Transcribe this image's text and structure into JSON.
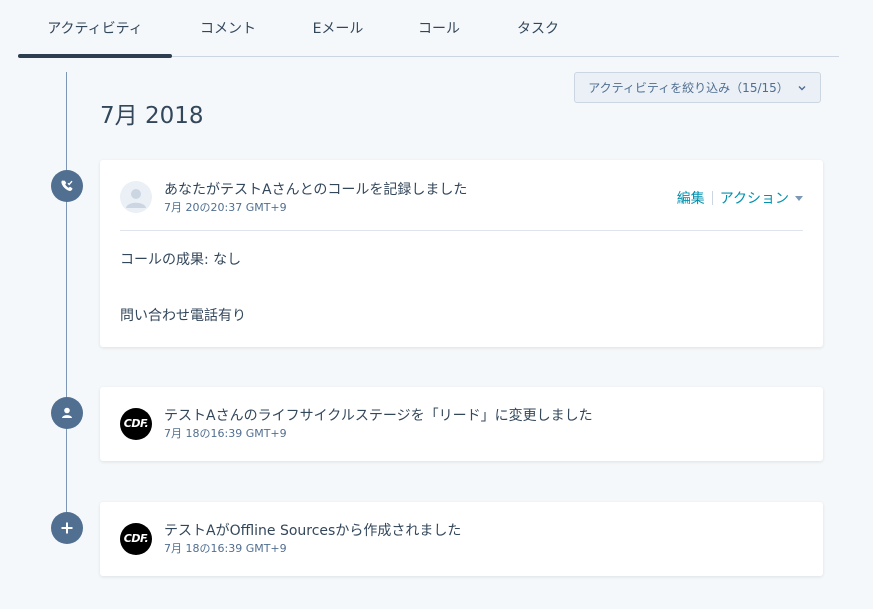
{
  "tabs": [
    {
      "label": "アクティビティ",
      "active": true
    },
    {
      "label": "コメント",
      "active": false
    },
    {
      "label": "Eメール",
      "active": false
    },
    {
      "label": "コール",
      "active": false
    },
    {
      "label": "タスク",
      "active": false
    }
  ],
  "filter": {
    "label": "アクティビティを絞り込み（15/15）"
  },
  "month": "7月 2018",
  "activities": [
    {
      "type": "call",
      "icon": "phone-logged-icon",
      "avatar": "generic-user-avatar",
      "title": "あなたがテストAさんとのコールを記録しました",
      "time": "7月 20の20:37 GMT+9",
      "actions": {
        "edit": "編集",
        "action": "アクション"
      },
      "outcome": "コールの成果: なし",
      "note": "問い合わせ電話有り"
    },
    {
      "type": "lifecycle",
      "icon": "person-icon",
      "avatar": "CDF",
      "title": "テストAさんのライフサイクルステージを「リード」に変更しました",
      "time": "7月 18の16:39 GMT+9"
    },
    {
      "type": "created",
      "icon": "plus-icon",
      "avatar": "CDF",
      "title": "テストAがOffline Sourcesから作成されました",
      "time": "7月 18の16:39 GMT+9"
    }
  ],
  "colors": {
    "background": "#f5f8fa",
    "tab_indicator": "#2d3e50",
    "timeline_icon": "#516f90",
    "link": "#0091ae"
  }
}
